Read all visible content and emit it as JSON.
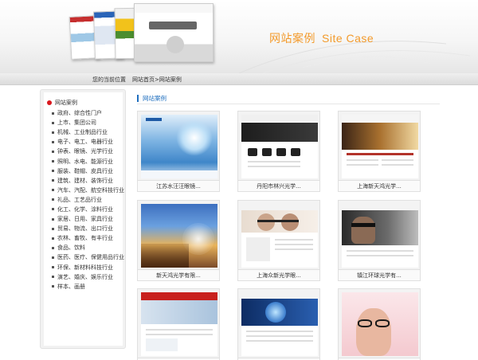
{
  "banner": {
    "title_cn": "网站案例",
    "title_en": "Site Case"
  },
  "breadcrumb": {
    "label": "您的当前位置",
    "path": "网站首页>网站案例"
  },
  "sidebar": {
    "heading": "网站案例",
    "items": [
      "政府、综合性门户",
      "上市、集团公司",
      "机械、工业制品行业",
      "电子、电工、电器行业",
      "钟表、眼镜、光学行业",
      "照明、水电、能源行业",
      "服装、鞋帽、皮具行业",
      "建筑、建材、装饰行业",
      "汽车、汽配、航空科技行业",
      "礼品、工艺品行业",
      "化工、化学、涂料行业",
      "家居、日用、家具行业",
      "贸易、物流、出口行业",
      "农林、畜牧、有丰行业",
      "食品、饮料",
      "医药、医疗、保健用品行业",
      "环保、新材料科技行业",
      "演艺、婚庆、娱乐行业",
      "样本、画册"
    ]
  },
  "main": {
    "heading": "网站案例",
    "cases": [
      {
        "caption": "江苏水汪汪眼镜..."
      },
      {
        "caption": "丹阳市林兴光学..."
      },
      {
        "caption": "上海新天鸿光学..."
      },
      {
        "caption": "新天鸿光学有限..."
      },
      {
        "caption": "上海众新光学眼..."
      },
      {
        "caption": "镇江环球光学有..."
      },
      {
        "caption": ""
      },
      {
        "caption": ""
      },
      {
        "caption": ""
      }
    ]
  },
  "colors": {
    "accent_orange": "#f39a2b",
    "accent_blue": "#1f6fbf",
    "bullet_red": "#d9181e"
  }
}
